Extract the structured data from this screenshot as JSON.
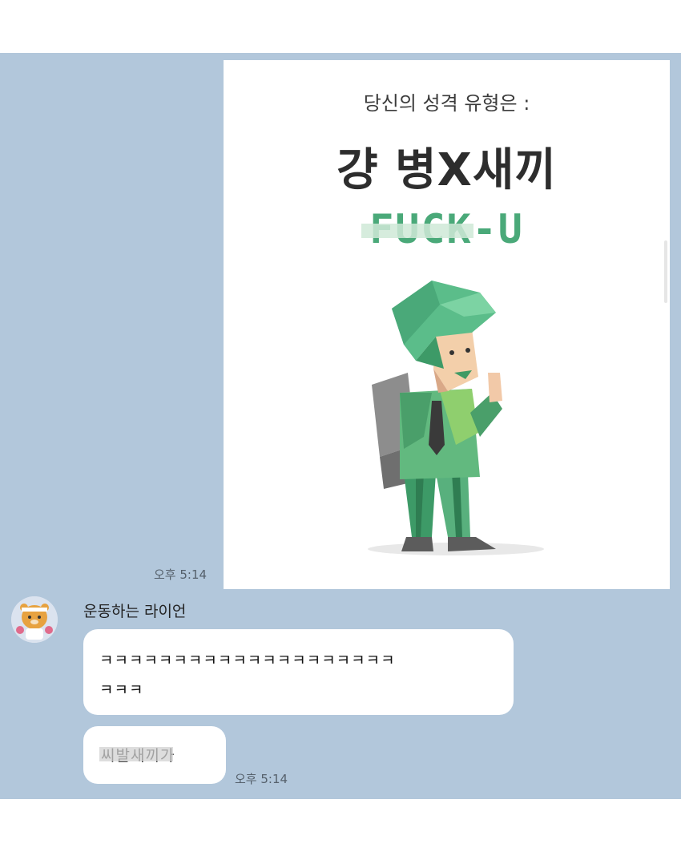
{
  "image_message": {
    "subtitle": "당신의 성격 유형은 :",
    "title": "걍 병X새끼",
    "english_title": "FUCK-U",
    "time": "오후 5:14"
  },
  "received": {
    "sender_name": "운동하는 라이언",
    "messages": [
      {
        "lines": [
          "ㅋㅋㅋㅋㅋㅋㅋㅋㅋㅋㅋㅋㅋㅋㅋㅋㅋㅋㅋㅋ",
          "ㅋㅋㅋ"
        ]
      },
      {
        "text": "씨발새끼가"
      }
    ],
    "time": "오후 5:14"
  },
  "colors": {
    "chat_background": "#b2c7db",
    "bubble": "#ffffff",
    "accent_green": "#4aa979"
  },
  "icons": {
    "avatar": "ryan-character-icon",
    "illustration": "low-poly-green-character-icon"
  }
}
